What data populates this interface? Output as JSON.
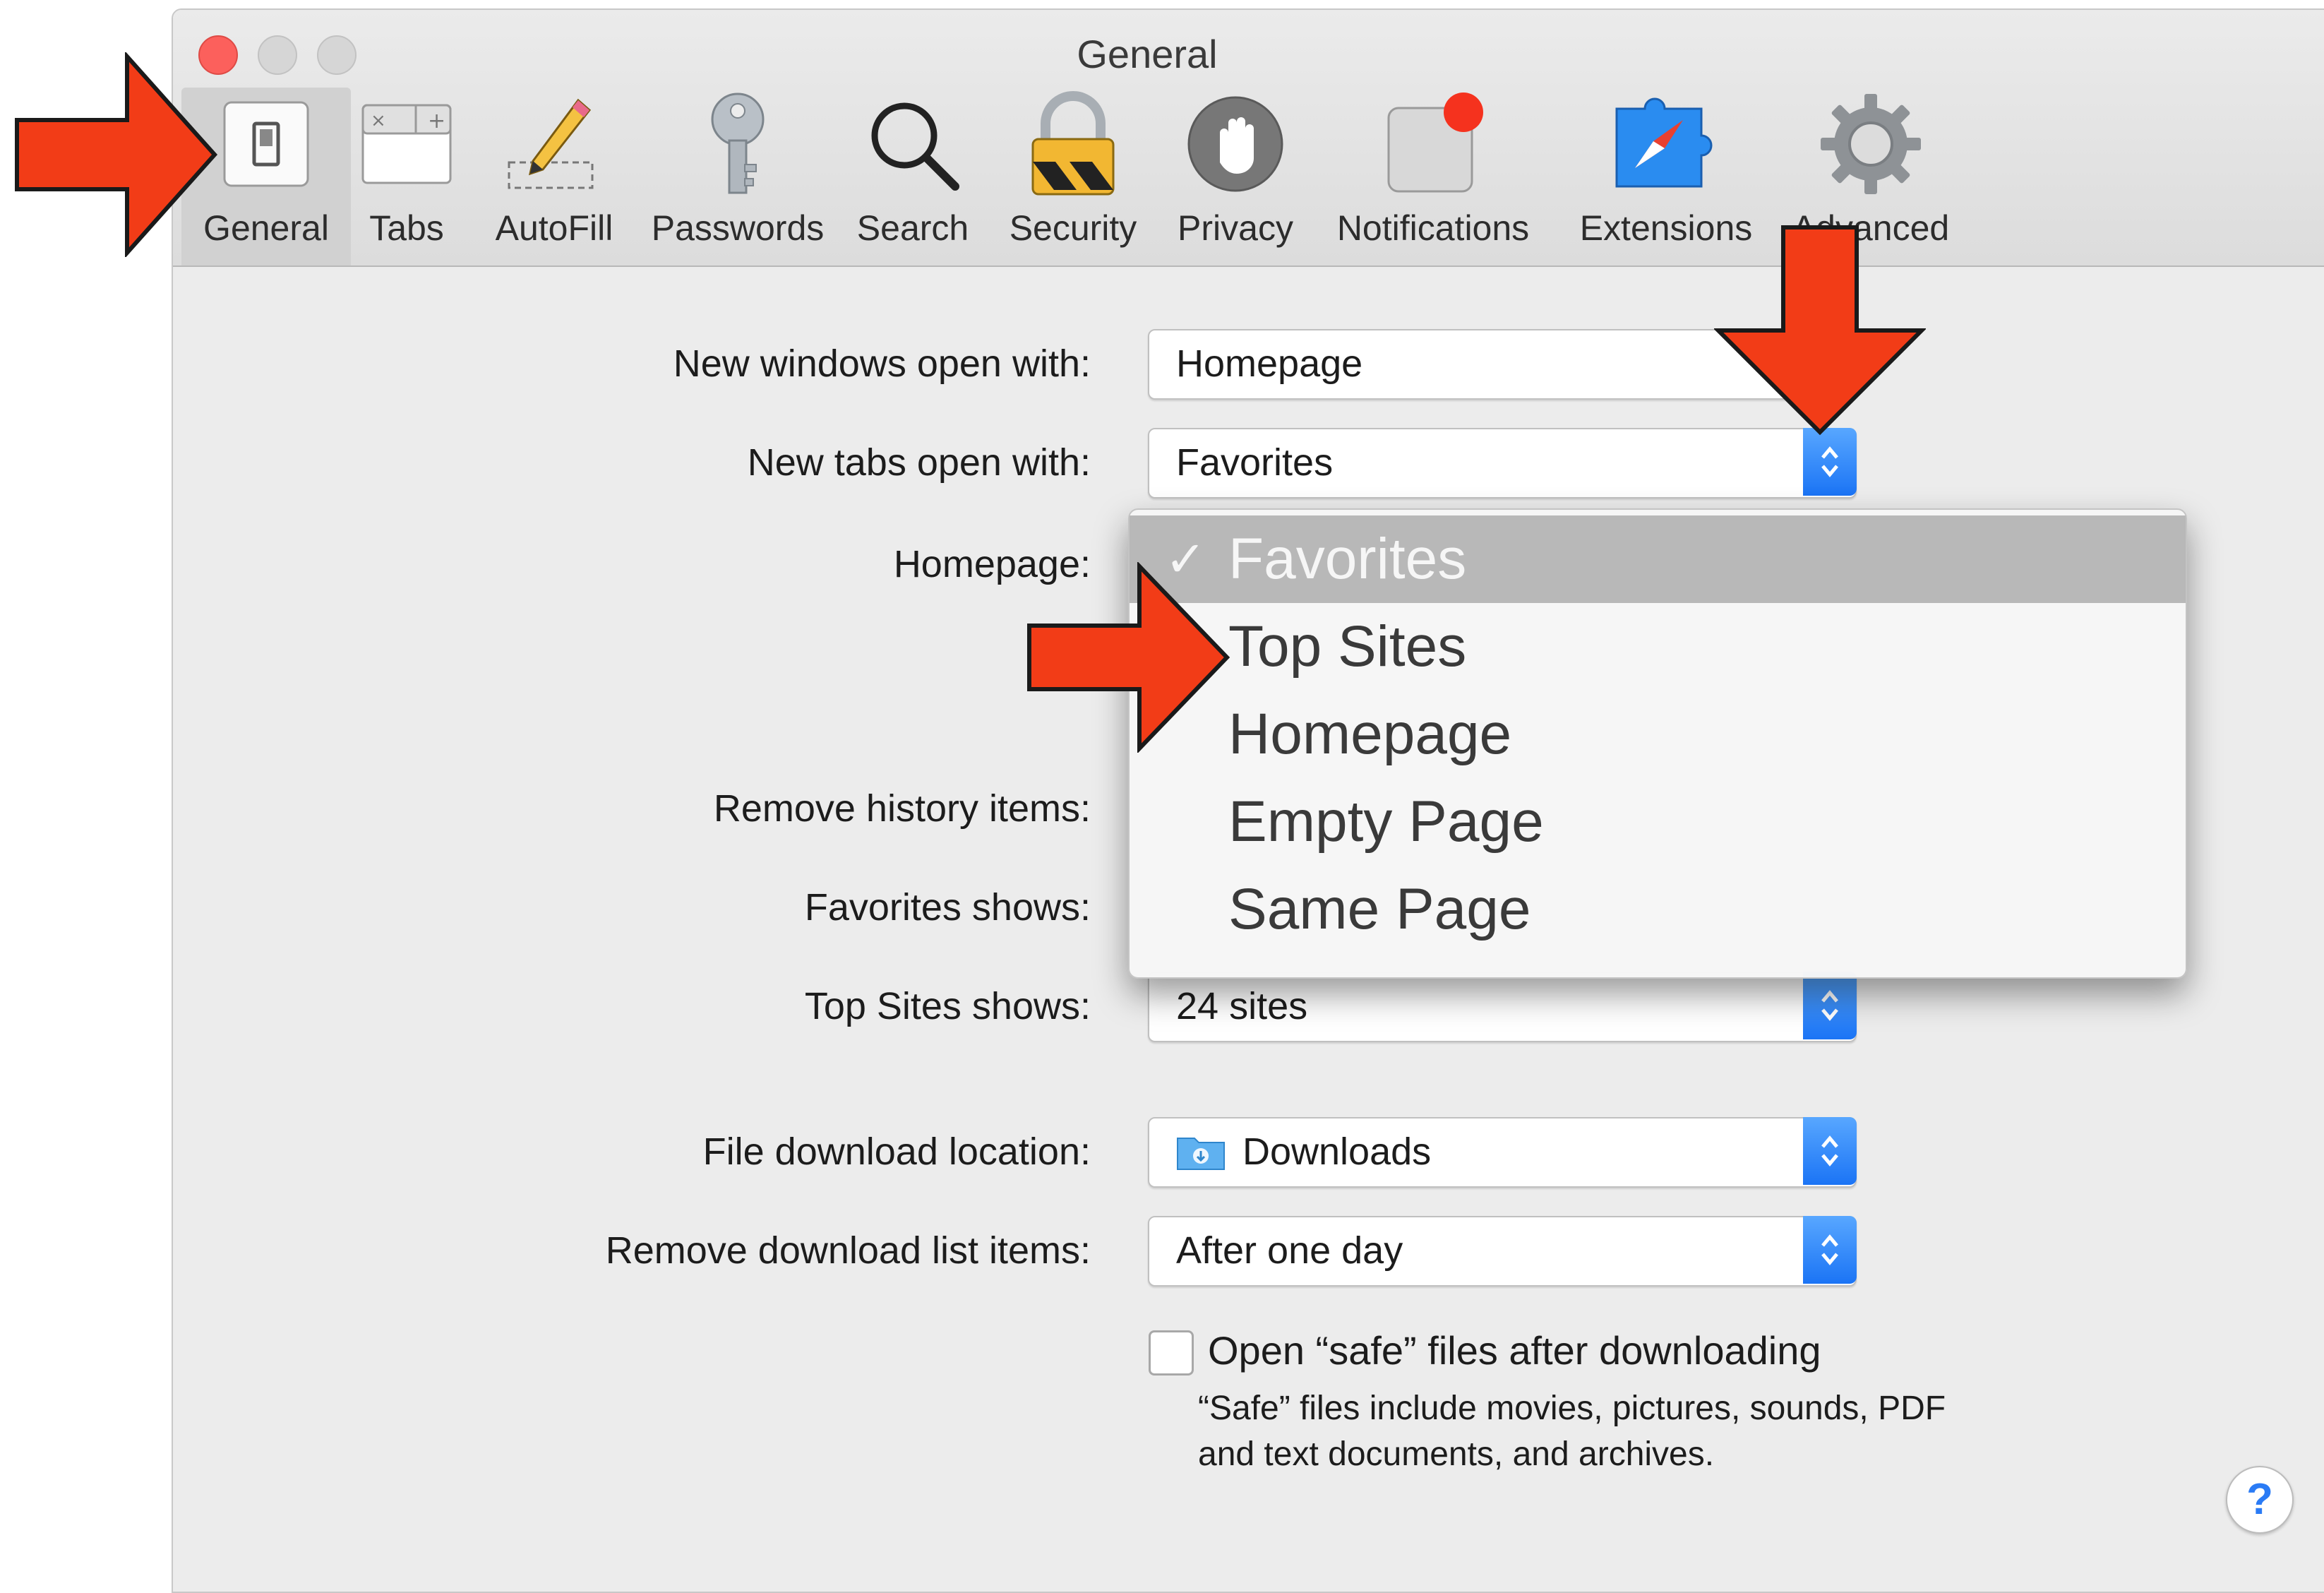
{
  "window": {
    "title": "General"
  },
  "toolbar": {
    "items": [
      {
        "label": "General",
        "icon": "general-switch-icon",
        "selected": true
      },
      {
        "label": "Tabs",
        "icon": "tabs-icon"
      },
      {
        "label": "AutoFill",
        "icon": "pencil-icon"
      },
      {
        "label": "Passwords",
        "icon": "key-icon"
      },
      {
        "label": "Search",
        "icon": "magnifier-icon"
      },
      {
        "label": "Security",
        "icon": "padlock-icon"
      },
      {
        "label": "Privacy",
        "icon": "hand-icon"
      },
      {
        "label": "Notifications",
        "icon": "notification-badge-icon"
      },
      {
        "label": "Extensions",
        "icon": "compass-puzzle-icon"
      },
      {
        "label": "Advanced",
        "icon": "gear-icon"
      }
    ]
  },
  "form": {
    "new_windows_label": "New windows open with:",
    "new_windows_value": "Homepage",
    "new_tabs_label": "New tabs open with:",
    "new_tabs_value": "Favorites",
    "homepage_label": "Homepage:",
    "remove_history_label": "Remove history items:",
    "favorites_shows_label": "Favorites shows:",
    "top_sites_label": "Top Sites shows:",
    "top_sites_value": "24 sites",
    "download_location_label": "File download location:",
    "download_location_value": "Downloads",
    "remove_download_label": "Remove download list items:",
    "remove_download_value": "After one day",
    "open_safe_label": "Open “safe” files after downloading",
    "open_safe_checked": false,
    "safe_note": "“Safe” files include movies, pictures, sounds, PDF and text documents, and archives."
  },
  "dropdown_menu": {
    "check_glyph": "✓",
    "items": [
      "Favorites",
      "Top Sites",
      "Homepage",
      "Empty Page",
      "Same Page"
    ],
    "selected": "Favorites"
  },
  "help": {
    "glyph": "?"
  },
  "colors": {
    "accent": "#1b74f5",
    "arrow": "#f23c17",
    "close": "#fc605c"
  }
}
